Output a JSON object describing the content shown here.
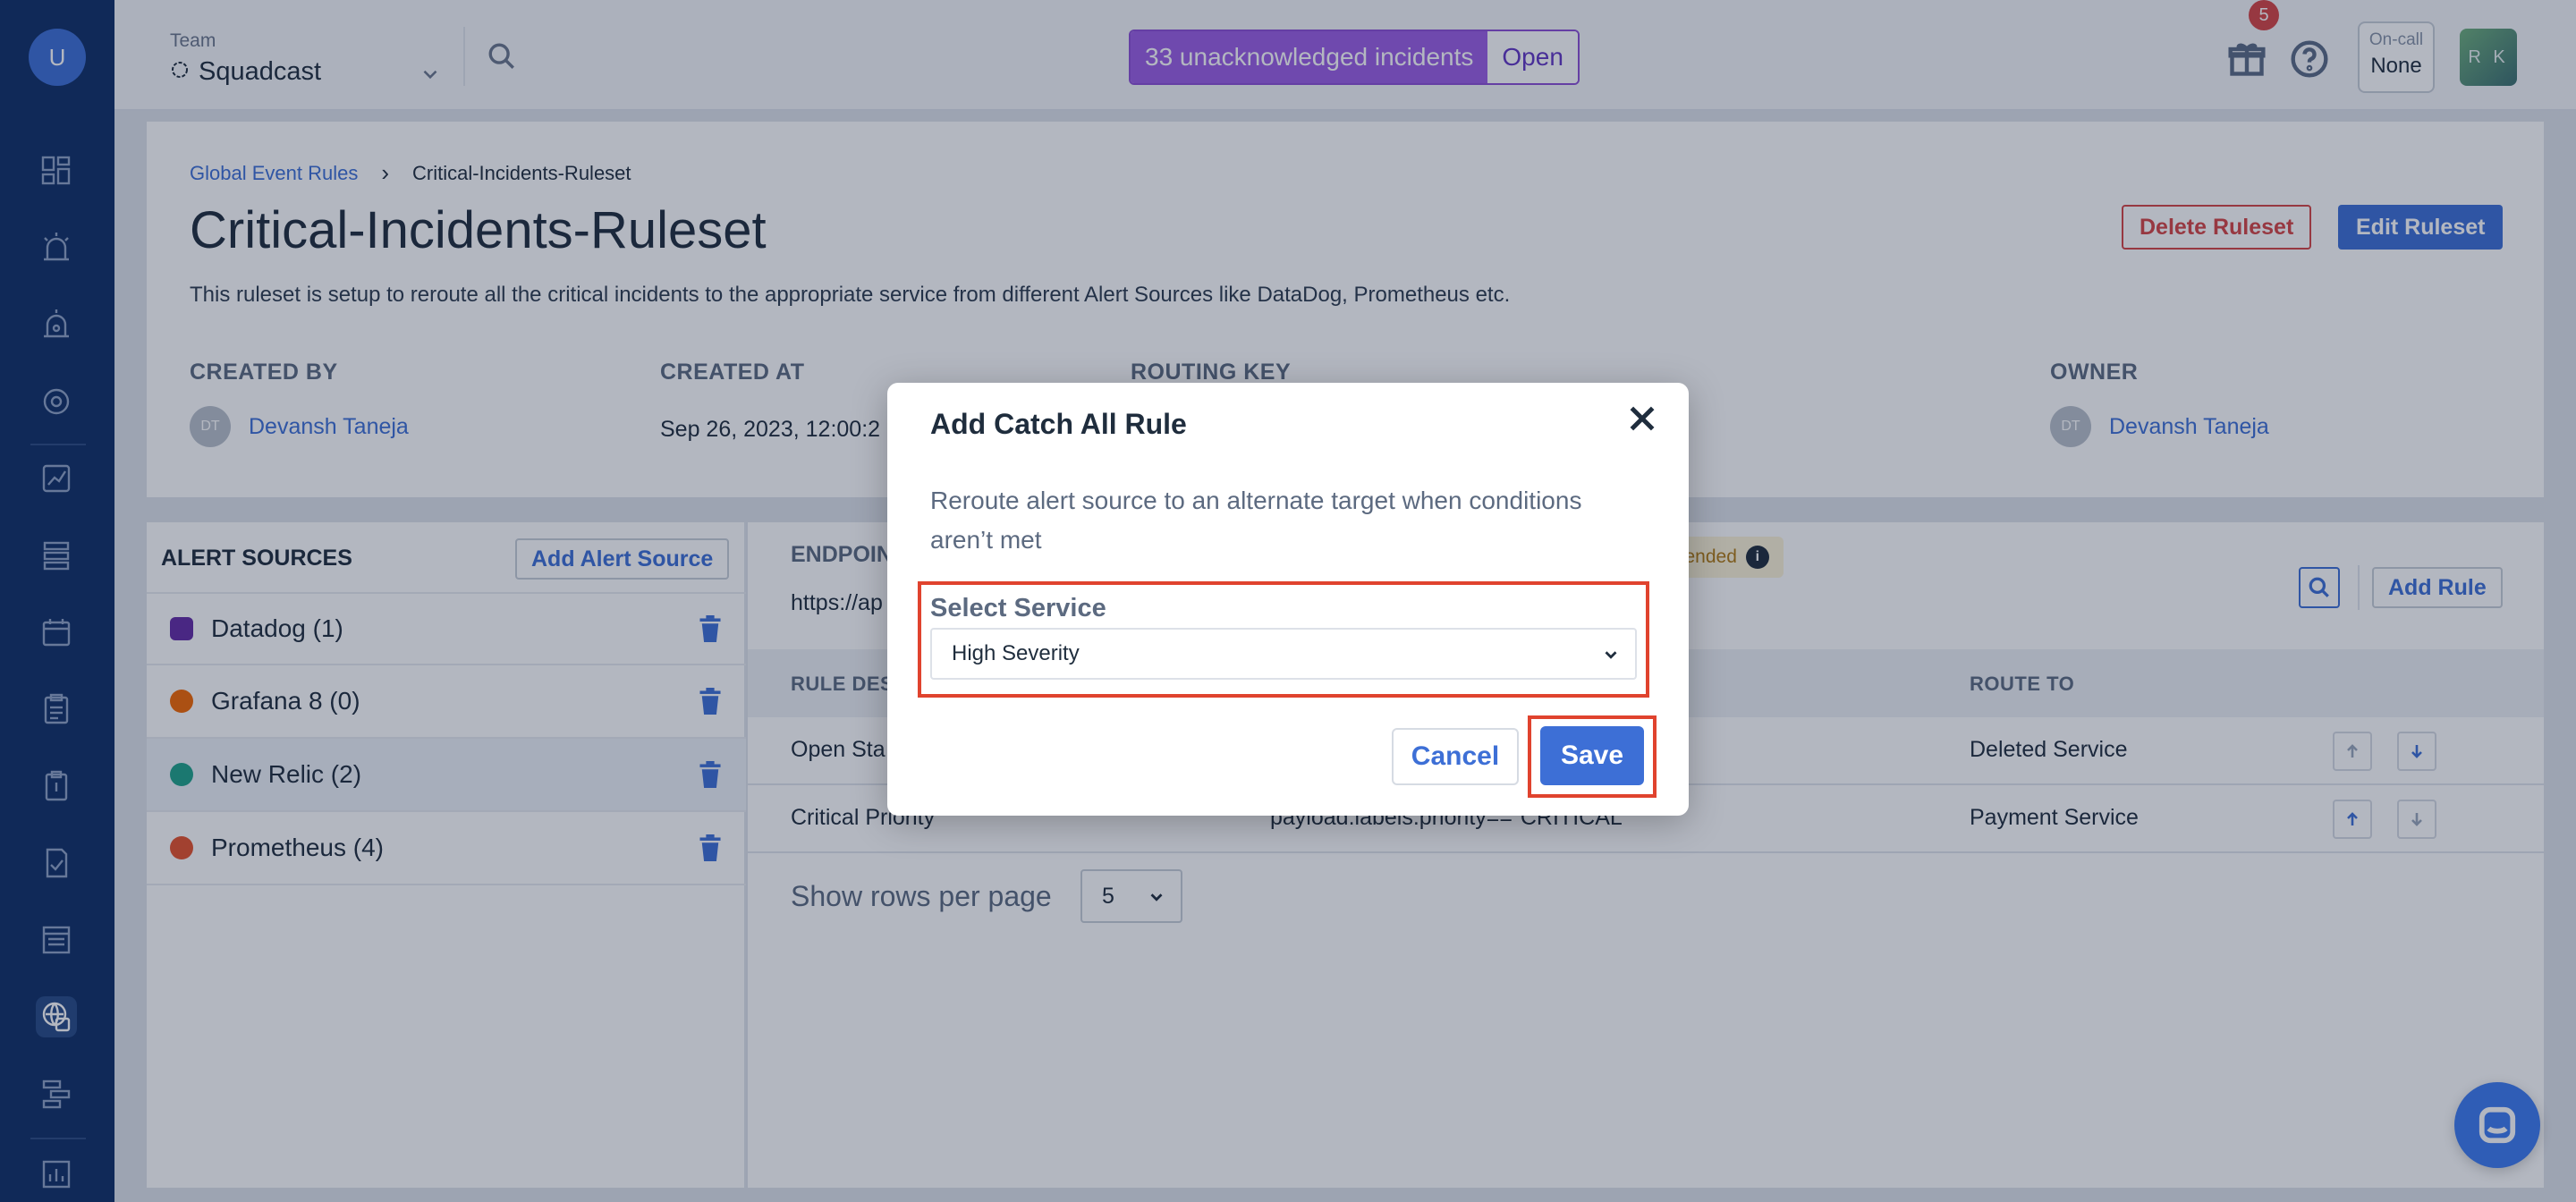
{
  "user_initial": "U",
  "topbar": {
    "team_label": "Team",
    "team_name": "Squadcast",
    "incidents_text": "33 unacknowledged incidents",
    "open_label": "Open",
    "notifications_count": "5",
    "oncall_label": "On-call",
    "oncall_value": "None",
    "avatar_initials": "R K"
  },
  "breadcrumb": {
    "parent": "Global Event Rules",
    "separator": "›",
    "current": "Critical-Incidents-Ruleset"
  },
  "ruleset": {
    "title": "Critical-Incidents-Ruleset",
    "delete_label": "Delete Ruleset",
    "edit_label": "Edit Ruleset",
    "description": "This ruleset is setup to reroute all the critical incidents to the appropriate service from different Alert Sources like DataDog, Prometheus etc.",
    "created_by_label": "CREATED BY",
    "created_by_initials": "DT",
    "created_by": "Devansh Taneja",
    "created_at_label": "CREATED AT",
    "created_at": "Sep 26, 2023, 12:00:2",
    "routing_key_label": "ROUTING KEY",
    "owner_label": "OWNER",
    "owner_initials": "DT",
    "owner": "Devansh Taneja"
  },
  "alert_sources": {
    "title": "ALERT SOURCES",
    "add_label": "Add Alert Source",
    "items": [
      {
        "name": "Datadog (1)",
        "color": "#632ca6"
      },
      {
        "name": "Grafana 8 (0)",
        "color": "#f46800"
      },
      {
        "name": "New Relic (2)",
        "color": "#1ce783"
      },
      {
        "name": "Prometheus (4)",
        "color": "#e6522c"
      }
    ]
  },
  "rules": {
    "endpoint_label": "ENDPOIN",
    "endpoint_url": "https://ap",
    "recommended_text": "mended",
    "add_rule_label": "Add Rule",
    "col_description": "RULE DES",
    "col_route": "ROUTE TO",
    "rows": [
      {
        "description": "Open Sta",
        "expression": "",
        "route": "Deleted Service"
      },
      {
        "description": "Critical Priority",
        "expression": "payload.labels.priority==\"CRITICAL\"",
        "route": "Payment Service"
      }
    ],
    "rows_per_page_label": "Show rows per page",
    "rows_per_page": "5"
  },
  "modal": {
    "title": "Add Catch All Rule",
    "description": "Reroute alert source to an alternate target when conditions aren’t met",
    "field_label": "Select Service",
    "selected_service": "High Severity",
    "cancel_label": "Cancel",
    "save_label": "Save"
  },
  "colors": {
    "accent": "#3d6fd6",
    "highlight": "#e0432e",
    "incident_purple": "#9b5de5",
    "danger": "#d64545"
  }
}
